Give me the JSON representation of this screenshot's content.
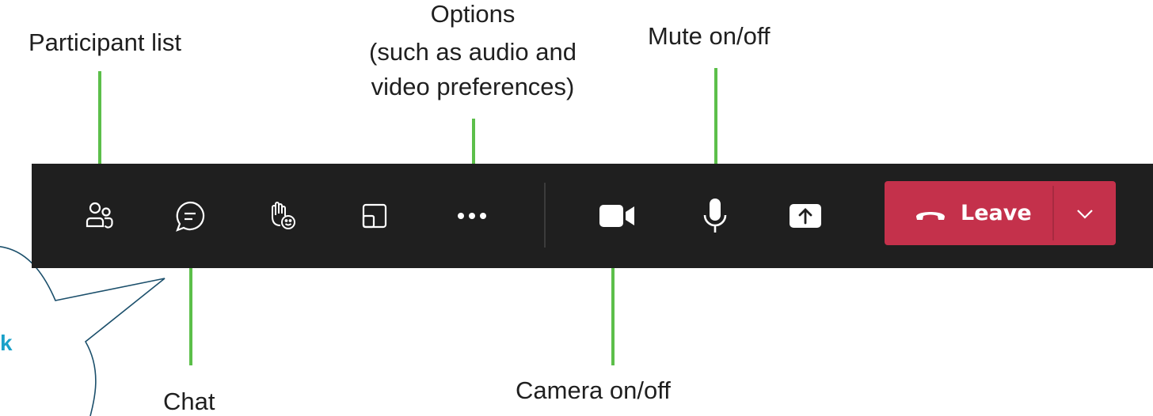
{
  "annotations": {
    "participants": "Participant list",
    "options_line1": "Options",
    "options_line2": "(such as audio and",
    "options_line3": "video preferences)",
    "mute": "Mute on/off",
    "chat": "Chat",
    "camera": "Camera on/off"
  },
  "toolbar": {
    "buttons": [
      {
        "name": "participants",
        "icon": "people-icon"
      },
      {
        "name": "chat",
        "icon": "chat-bubble-icon"
      },
      {
        "name": "reactions",
        "icon": "raise-hand-emoji-icon"
      },
      {
        "name": "view",
        "icon": "layout-icon"
      },
      {
        "name": "more-options",
        "icon": "ellipsis-icon"
      },
      {
        "name": "camera",
        "icon": "video-camera-icon"
      },
      {
        "name": "microphone",
        "icon": "microphone-icon"
      },
      {
        "name": "share",
        "icon": "share-screen-icon"
      }
    ],
    "leave_label": "Leave"
  },
  "callout": {
    "partial_text": "k"
  },
  "colors": {
    "toolbar_bg": "#1f1f1f",
    "leave_red": "#c4314b",
    "pointer_green": "#5cbf4a",
    "callout_outline": "#1b4f6b",
    "callout_text": "#1aa1c9"
  }
}
